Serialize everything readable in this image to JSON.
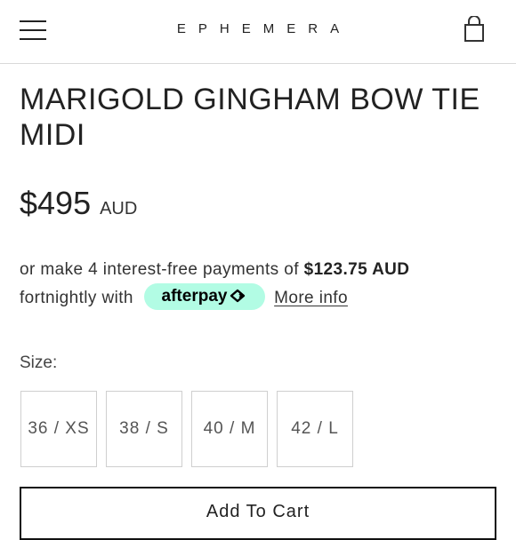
{
  "header": {
    "logo": "EPHEMERA",
    "menu_icon": "hamburger-menu-icon",
    "cart_icon": "shopping-bag-icon"
  },
  "product": {
    "title": "MARIGOLD GINGHAM BOW TIE MIDI",
    "price": "$495",
    "currency": "AUD"
  },
  "installments": {
    "prefix": "or make 4 interest-free payments of",
    "amount": "$123.75 AUD",
    "suffix": "fortnightly with",
    "badge_label": "afterpay",
    "badge_color": "#b2fce4",
    "more_info": "More info"
  },
  "size_selector": {
    "label": "Size:",
    "options": [
      "36 / XS",
      "38 / S",
      "40 / M",
      "42 / L"
    ]
  },
  "cart": {
    "button_label": "Add To Cart"
  }
}
